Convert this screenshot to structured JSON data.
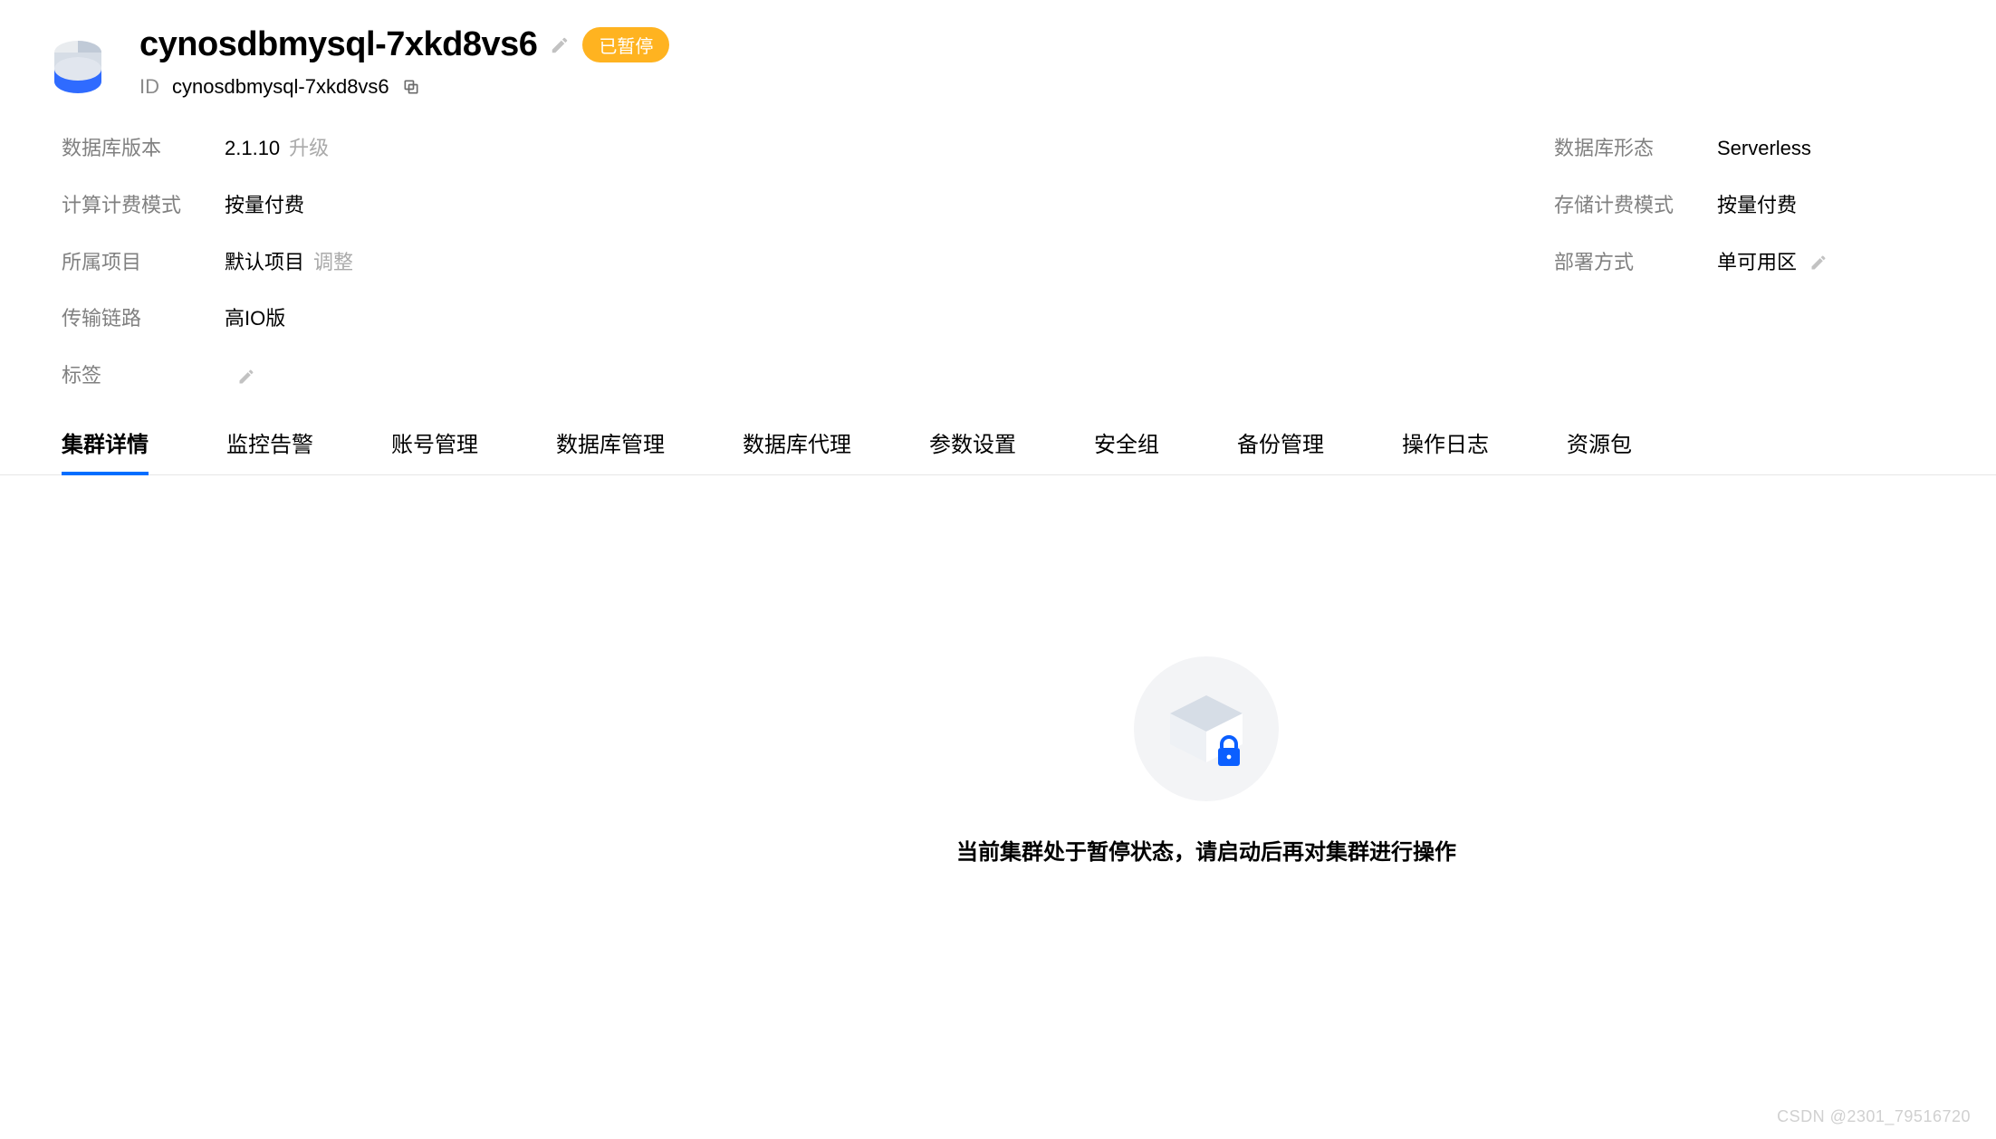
{
  "header": {
    "title": "cynosdbmysql-7xkd8vs6",
    "id_label": "ID",
    "id_value": "cynosdbmysql-7xkd8vs6",
    "status": "已暂停"
  },
  "props": {
    "left": {
      "db_version_label": "数据库版本",
      "db_version_value": "2.1.10",
      "db_version_action": "升级",
      "compute_billing_label": "计算计费模式",
      "compute_billing_value": "按量付费",
      "project_label": "所属项目",
      "project_value": "默认项目",
      "project_action": "调整",
      "transport_label": "传输链路",
      "transport_value": "高IO版",
      "tags_label": "标签"
    },
    "right": {
      "db_type_label": "数据库形态",
      "db_type_value": "Serverless",
      "storage_billing_label": "存储计费模式",
      "storage_billing_value": "按量付费",
      "deploy_label": "部署方式",
      "deploy_value": "单可用区"
    }
  },
  "tabs": [
    "集群详情",
    "监控告警",
    "账号管理",
    "数据库管理",
    "数据库代理",
    "参数设置",
    "安全组",
    "备份管理",
    "操作日志",
    "资源包"
  ],
  "empty_state": {
    "message": "当前集群处于暂停状态，请启动后再对集群进行操作"
  },
  "watermark": "CSDN @2301_79516720"
}
